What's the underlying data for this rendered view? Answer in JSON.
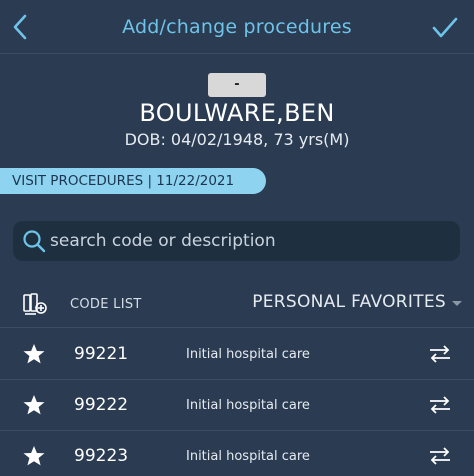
{
  "header": {
    "title": "Add/change procedures"
  },
  "patient": {
    "badge": "-",
    "name": "BOULWARE,BEN",
    "dob": "DOB: 04/02/1948, 73 yrs(M)"
  },
  "visit": {
    "label": "VISIT PROCEDURES | 11/22/2021"
  },
  "search": {
    "placeholder": "search code or description"
  },
  "list_header": {
    "code_list_label": "CODE LIST",
    "favorites_label": "PERSONAL FAVORITES"
  },
  "colors": {
    "background": "#2a3b52",
    "accent": "#6ec3e8",
    "pill": "#8ed4f0",
    "search_bg": "#1e3040"
  },
  "icons": {
    "back": "chevron-left-icon",
    "done": "checkmark-icon",
    "search": "search-icon",
    "list": "code-list-icon",
    "favorite": "star-icon",
    "swap": "swap-arrows-icon"
  },
  "procedures": [
    {
      "code": "99221",
      "description": "Initial hospital care"
    },
    {
      "code": "99222",
      "description": "Initial hospital care"
    },
    {
      "code": "99223",
      "description": "Initial hospital care"
    }
  ]
}
